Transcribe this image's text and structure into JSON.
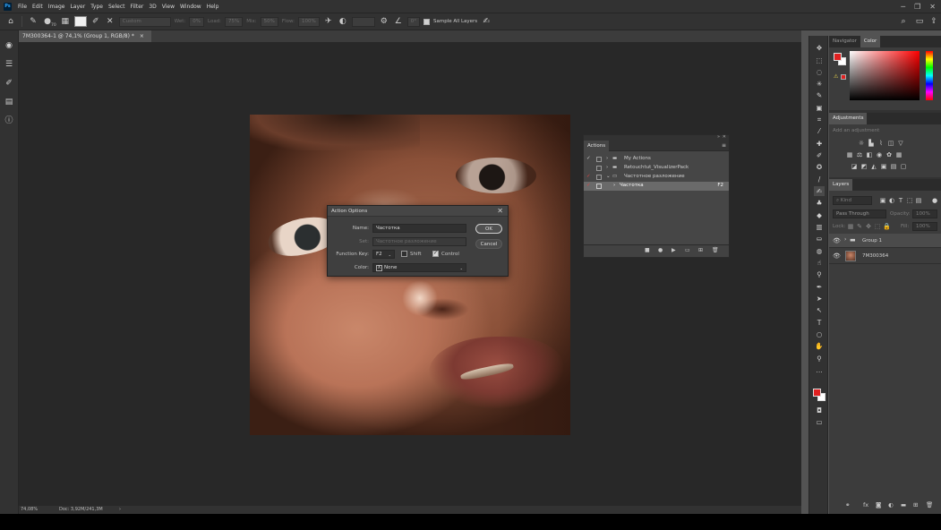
{
  "menubar": {
    "logo": "Ps",
    "items": [
      "File",
      "Edit",
      "Image",
      "Layer",
      "Type",
      "Select",
      "Filter",
      "3D",
      "View",
      "Window",
      "Help"
    ],
    "window_controls": [
      "─",
      "❐",
      "✕"
    ]
  },
  "options_bar": {
    "brush_size": "70",
    "custom_label": "Custom",
    "width_label": "Wet:",
    "width_value": "0%",
    "load_label": "Load:",
    "load_value": "75%",
    "mix_label": "Mix:",
    "mix_value": "50%",
    "flow_label": "Flow:",
    "flow_value": "100%",
    "angle_value": "0°",
    "sample_all_layers": "Sample All Layers"
  },
  "document": {
    "tab_title": "7M300364-1 @ 74,1% (Group 1, RGB/8) *",
    "close": "×"
  },
  "dialog": {
    "title": "Action Options",
    "name_label": "Name:",
    "name_value": "Частотка",
    "set_label": "Set:",
    "set_value": "Частотное разложение",
    "function_key_label": "Function Key:",
    "function_key_value": "F2",
    "shift_label": "Shift",
    "shift_checked": false,
    "control_label": "Control",
    "control_checked": true,
    "color_label": "Color:",
    "color_value": "None",
    "color_x": "X",
    "ok_label": "OK",
    "cancel_label": "Cancel",
    "close": "✕"
  },
  "actions_panel": {
    "tab": "Actions",
    "menu": "≡",
    "collapse": "»",
    "close": "✕",
    "rows": [
      {
        "name": "My Actions",
        "check": "✓",
        "type": "folder"
      },
      {
        "name": "Retouchtut_VisualizerPack",
        "check": "",
        "type": "folder"
      },
      {
        "name": "Частотное разложение",
        "check": "✓",
        "type": "folder-open"
      },
      {
        "name": "Частотка",
        "check": "✓",
        "type": "action",
        "key": "F2"
      }
    ]
  },
  "right_panels": {
    "color_tabs": [
      "Navigator",
      "Color"
    ],
    "adjustments_tab": "Adjustments",
    "adjustments_hint": "Add an adjustment",
    "layers_tab": "Layers",
    "kind_label": "Kind",
    "blend_mode": "Pass Through",
    "opacity_label": "Opacity:",
    "opacity_value": "100%",
    "lock_label": "Lock:",
    "fill_label": "Fill:",
    "fill_value": "100%",
    "layers": [
      {
        "name": "Group 1",
        "type": "group",
        "selected": true
      },
      {
        "name": "7M300364",
        "type": "image",
        "selected": false
      }
    ]
  },
  "status_bar": {
    "zoom": "74,08%",
    "doc_info": "Doc: 3,92M/241,3M",
    "arrow": "›"
  },
  "colors": {
    "foreground": "#e02020",
    "background": "#ffffff",
    "accent": "#31a8ff"
  }
}
